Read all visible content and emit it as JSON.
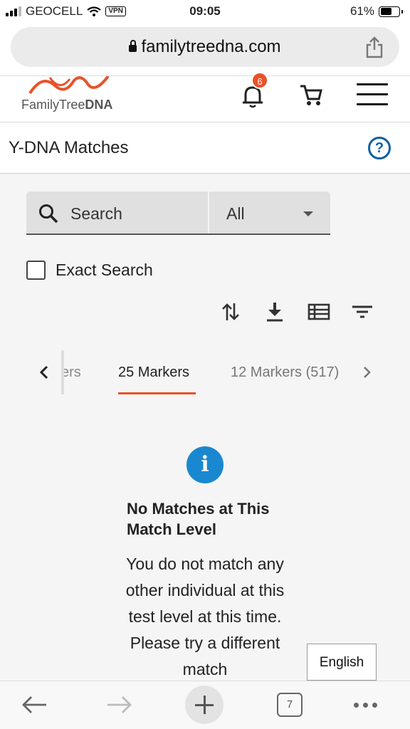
{
  "status_bar": {
    "carrier": "GEOCELL",
    "vpn": "VPN",
    "time": "09:05",
    "battery_percent": "61%",
    "battery_level": 0.61
  },
  "browser": {
    "url": "familytreedna.com",
    "tab_count": "7"
  },
  "site_header": {
    "logo_text": "FamilyTree",
    "logo_text_bold": "DNA",
    "notification_count": "6",
    "brand_color": "#e8522a"
  },
  "page": {
    "title": "Y-DNA Matches",
    "help_label": "?"
  },
  "search": {
    "placeholder": "Search",
    "filter_value": "All"
  },
  "exact_search": {
    "label": "Exact Search",
    "checked": false
  },
  "tabs": {
    "partial_label": "ers",
    "active_label": "25 Markers",
    "next_label": "12 Markers (517)"
  },
  "message": {
    "icon_label": "i",
    "title": "No Matches at This Match Level",
    "body": "You do not match any other individual at this test level at this time. Please try a different match"
  },
  "language": {
    "label": "English"
  }
}
